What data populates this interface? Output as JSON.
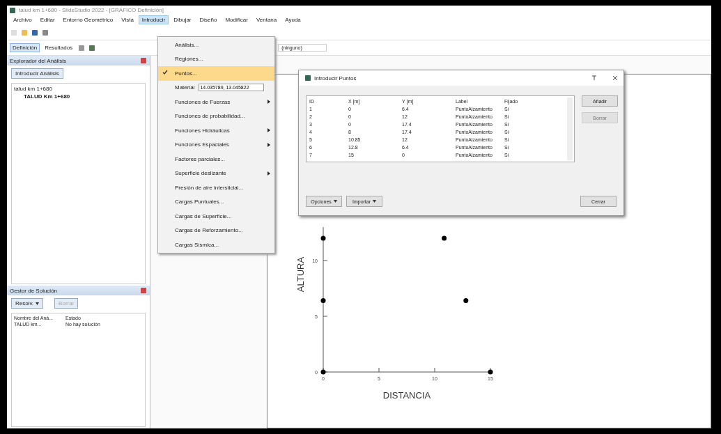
{
  "window": {
    "title": "talud km 1+680 - SlideStudio 2022 - [GRAFICO Definición]"
  },
  "menu": [
    {
      "label": "Archivo",
      "selected": false
    },
    {
      "label": "Editar",
      "selected": false
    },
    {
      "label": "Entorno Geométrico",
      "selected": false
    },
    {
      "label": "Vista",
      "selected": false
    },
    {
      "label": "Introducir",
      "selected": true
    },
    {
      "label": "Dibujar",
      "selected": false
    },
    {
      "label": "Diseño",
      "selected": false
    },
    {
      "label": "Modificar",
      "selected": false
    },
    {
      "label": "Ventana",
      "selected": false
    },
    {
      "label": "Ayuda",
      "selected": false
    }
  ],
  "toolbar": {
    "modes": [
      {
        "label": "Definición",
        "selected": true
      },
      {
        "label": "Resultados",
        "selected": false
      }
    ],
    "combo": "(ninguno)"
  },
  "dropdown": [
    {
      "kind": "item",
      "label": "Análisis...",
      "checked": false,
      "submenu": false
    },
    {
      "kind": "item",
      "label": "Regiones...",
      "checked": false,
      "submenu": false
    },
    {
      "kind": "item",
      "label": "Puntos...",
      "checked": true,
      "submenu": false
    },
    {
      "kind": "field",
      "label": "Material",
      "value": "14.035789, 13.045822"
    },
    {
      "kind": "item",
      "label": "Funciones de Fuerzas",
      "checked": false,
      "submenu": true
    },
    {
      "kind": "item",
      "label": "Funciones de probabilidad...",
      "checked": false,
      "submenu": false
    },
    {
      "kind": "item",
      "label": "Funciones Hidráulicas",
      "checked": false,
      "submenu": true
    },
    {
      "kind": "item",
      "label": "Funciones Espaciales",
      "checked": false,
      "submenu": true
    },
    {
      "kind": "item",
      "label": "Factores parciales...",
      "checked": false,
      "submenu": false
    },
    {
      "kind": "item",
      "label": "Superficie deslizante",
      "checked": false,
      "submenu": true
    },
    {
      "kind": "item",
      "label": "Presión de aire intersticial...",
      "checked": false,
      "submenu": false
    },
    {
      "kind": "item",
      "label": "Cargas Puntuales...",
      "checked": false,
      "submenu": false
    },
    {
      "kind": "item",
      "label": "Cargas de Superficie...",
      "checked": false,
      "submenu": false
    },
    {
      "kind": "item",
      "label": "Cargas de Reforzamiento...",
      "checked": false,
      "submenu": false
    },
    {
      "kind": "item",
      "label": "Cargas Sísmica...",
      "checked": false,
      "submenu": false
    }
  ],
  "explorer": {
    "title": "Explorador del Análisis",
    "button": "Introducir Análisis",
    "tree": [
      {
        "label": "talud km 1+680",
        "children": [
          {
            "label": "TALUD Km 1+680"
          }
        ]
      }
    ]
  },
  "solution": {
    "title": "Gestor de Solución",
    "solve": "Resolv.",
    "delete": "Borrar",
    "columns": [
      "Nombre del Aná...",
      "Estado"
    ],
    "rows": [
      [
        "TALUD km...",
        "No hay solución"
      ]
    ]
  },
  "dialog": {
    "title": "Introducir Puntos",
    "columns": [
      "ID",
      "X [m]",
      "Y [m]",
      "Label",
      "Fijado"
    ],
    "rows": [
      [
        "1",
        "0",
        "6.4",
        "PuntoAlzamiento",
        "Sí"
      ],
      [
        "2",
        "0",
        "12",
        "PuntoAlzamiento",
        "Sí"
      ],
      [
        "3",
        "0",
        "17.4",
        "PuntoAlzamiento",
        "Sí"
      ],
      [
        "4",
        "8",
        "17.4",
        "PuntoAlzamiento",
        "Sí"
      ],
      [
        "5",
        "10.85",
        "12",
        "PuntoAlzamiento",
        "Sí"
      ],
      [
        "6",
        "12.8",
        "6.4",
        "PuntoAlzamiento",
        "Sí"
      ],
      [
        "7",
        "15",
        "0",
        "PuntoAlzamiento",
        "Sí"
      ]
    ],
    "add": "Añadir",
    "remove": {
      "label": "Borrar",
      "disabled": true
    },
    "options": "Opciones",
    "import": "Importar",
    "close": "Cerrar"
  },
  "chart_data": {
    "type": "scatter",
    "xlabel": "DISTANCIA",
    "ylabel": "ALTURA",
    "xlim": [
      0,
      15
    ],
    "ylim": [
      0,
      13
    ],
    "xticks": [
      0,
      5,
      10,
      15
    ],
    "yticks": [
      0,
      5,
      10
    ],
    "x": [
      0,
      0,
      0,
      10.85,
      12.8,
      15
    ],
    "series": [
      {
        "color": "#000000",
        "values": [
          0,
          6.4,
          12,
          12,
          6.4,
          0
        ]
      }
    ]
  }
}
